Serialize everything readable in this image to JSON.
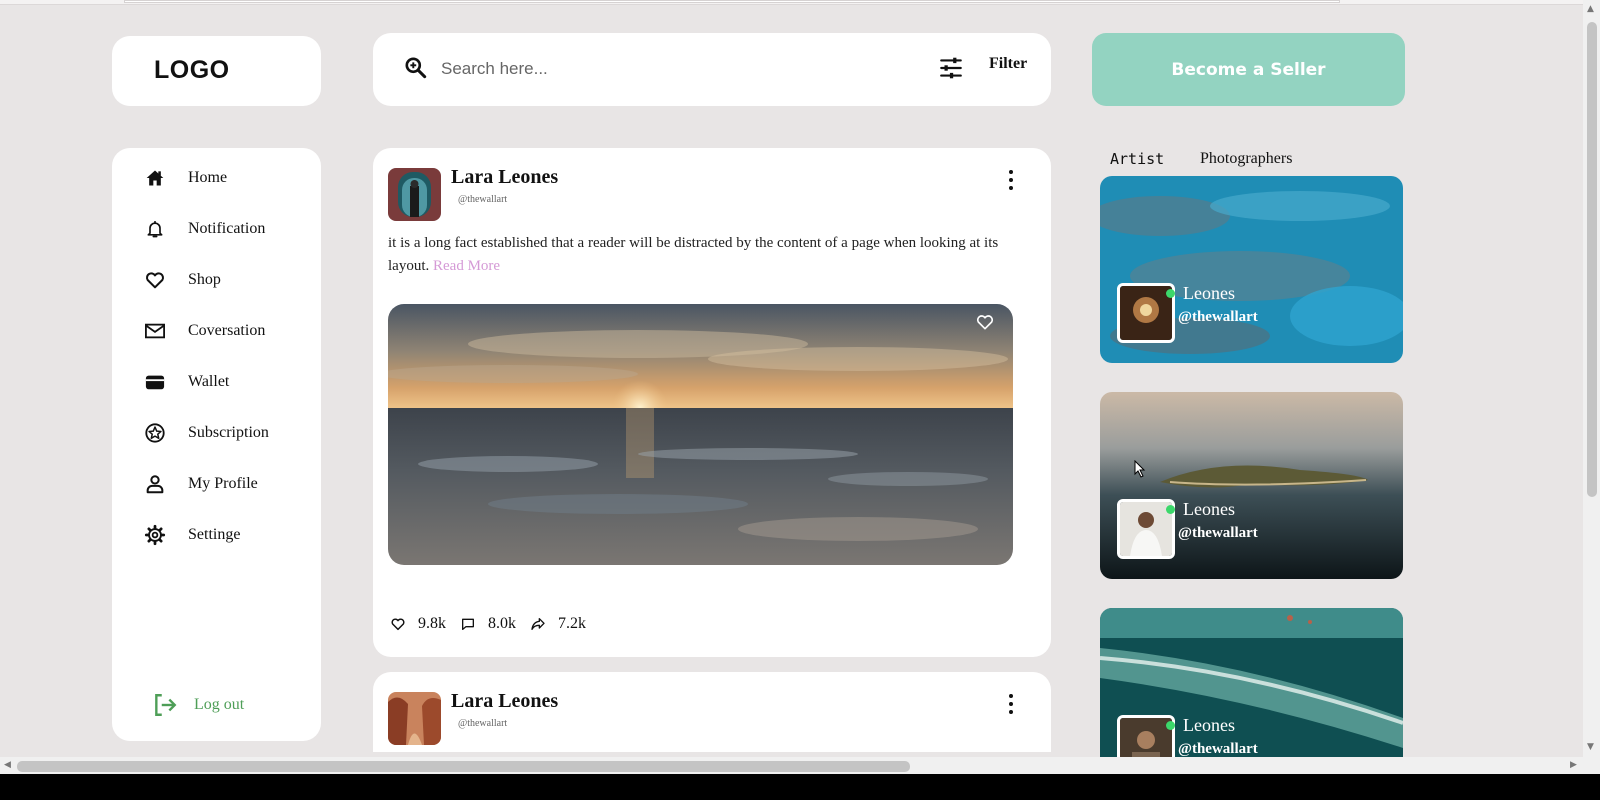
{
  "brand": {
    "logo_text": "LOGO"
  },
  "search": {
    "placeholder": "Search here...",
    "filter_label": "Filter"
  },
  "cta": {
    "label": "Become a Seller",
    "color": "#93d3c1"
  },
  "sidebar": {
    "items": [
      {
        "label": "Home",
        "icon": "home-icon"
      },
      {
        "label": "Notification",
        "icon": "bell-icon"
      },
      {
        "label": "Shop",
        "icon": "heart-icon"
      },
      {
        "label": "Coversation",
        "icon": "mail-icon"
      },
      {
        "label": "Wallet",
        "icon": "wallet-icon"
      },
      {
        "label": "Subscription",
        "icon": "star-circle-icon"
      },
      {
        "label": "My Profile",
        "icon": "user-icon"
      },
      {
        "label": "Settinge",
        "icon": "gear-icon"
      }
    ],
    "logout": {
      "label": "Log out",
      "icon": "logout-icon",
      "color": "#4e9e57"
    }
  },
  "feed": {
    "posts": [
      {
        "author": "Lara Leones",
        "handle": "@thewallart",
        "text": "it is a long fact established that a reader will be distracted by the content of a page when looking at its layout.",
        "read_more": "Read More",
        "likes": "9.8k",
        "comments": "8.0k",
        "shares": "7.2k"
      },
      {
        "author": "Lara Leones",
        "handle": "@thewallart"
      }
    ]
  },
  "right_panel": {
    "tabs": [
      "Artist",
      "Photographers"
    ],
    "artists": [
      {
        "name": "Leones",
        "handle": "@thewallart"
      },
      {
        "name": "Leones",
        "handle": "@thewallart"
      },
      {
        "name": "Leones",
        "handle": "@thewallart"
      }
    ],
    "online_color": "#3cd86b"
  }
}
